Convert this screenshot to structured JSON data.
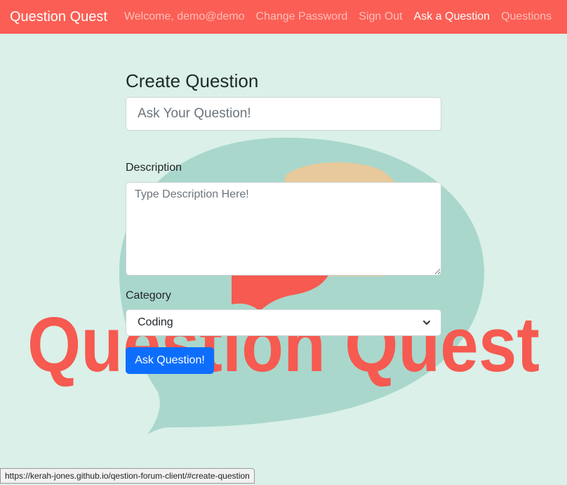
{
  "navbar": {
    "brand": "Question Quest",
    "links": [
      {
        "label": "Welcome, demo@demo"
      },
      {
        "label": "Change Password"
      },
      {
        "label": "Sign Out"
      },
      {
        "label": "Ask a Question"
      },
      {
        "label": "Questions"
      }
    ],
    "active_link": "Ask a Question",
    "bg_color": "#fb5e54"
  },
  "background": {
    "color": "#daf0e8",
    "logo_text": "Question Quest",
    "logo_text_color": "#f65a50",
    "bubble_color": "#a9d7cc",
    "accent_color": "#e8c99b"
  },
  "form": {
    "title": "Create Question",
    "question_placeholder": "Ask Your Question!",
    "description_label": "Description",
    "description_placeholder": "Type Description Here!",
    "category_label": "Category",
    "category_value": "Coding",
    "submit_label": "Ask Question!",
    "submit_color": "#0d6efd"
  },
  "status_bar": {
    "url": "https://kerah-jones.github.io/qestion-forum-client/#create-question"
  }
}
